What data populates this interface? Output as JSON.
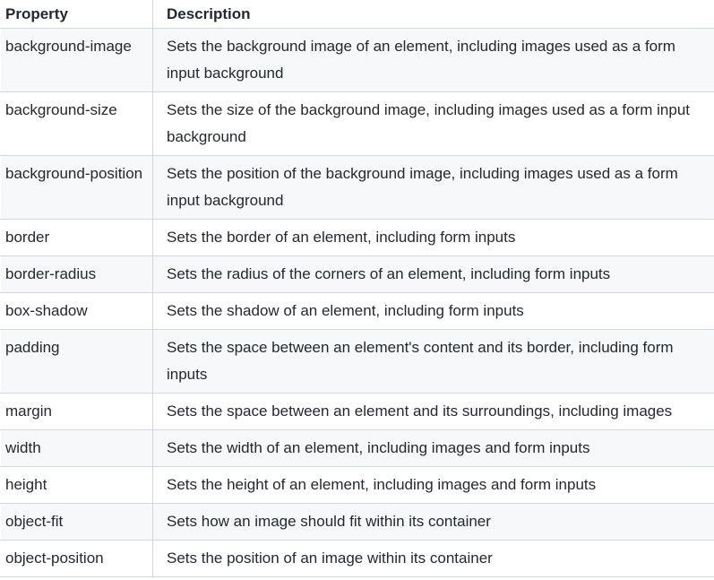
{
  "table": {
    "headers": [
      "Property",
      "Description"
    ],
    "rows": [
      [
        "background-image",
        "Sets the background image of an element, including images used as a form input background"
      ],
      [
        "background-size",
        "Sets the size of the background image, including images used as a form input background"
      ],
      [
        "background-position",
        "Sets the position of the background image, including images used as a form input background"
      ],
      [
        "border",
        "Sets the border of an element, including form inputs"
      ],
      [
        "border-radius",
        "Sets the radius of the corners of an element, including form inputs"
      ],
      [
        "box-shadow",
        "Sets the shadow of an element, including form inputs"
      ],
      [
        "padding",
        "Sets the space between an element's content and its border, including form inputs"
      ],
      [
        "margin",
        "Sets the space between an element and its surroundings, including images"
      ],
      [
        "width",
        "Sets the width of an element, including images and form inputs"
      ],
      [
        "height",
        "Sets the height of an element, including images and form inputs"
      ],
      [
        "object-fit",
        "Sets how an image should fit within its container"
      ],
      [
        "object-position",
        "Sets the position of an image within its container"
      ]
    ]
  }
}
